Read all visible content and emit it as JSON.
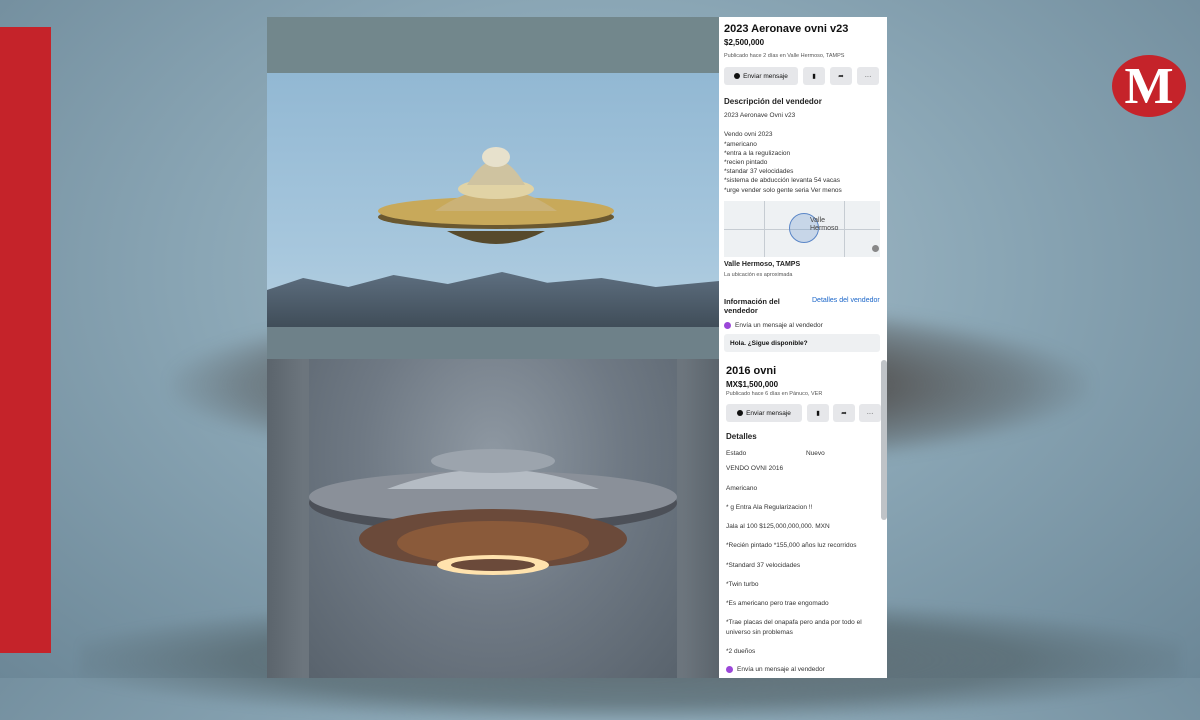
{
  "brand": {
    "logo_letter": "M",
    "accent": "#c5232a"
  },
  "listing1": {
    "title": "2023 Aeronave ovni v23",
    "price": "$2,500,000",
    "posted": "Publicado hace 2 días en Valle Hermoso, TAMPS",
    "actions": {
      "message": "Enviar mensaje"
    },
    "description_heading": "Descripción del vendedor",
    "description_lines": [
      "2023 Aeronave Ovni v23",
      "",
      "Vendo ovni 2023",
      "*americano",
      "*entra a la regulizacion",
      "*recien pintado",
      "*standar 37 velocidades",
      "*sistema de abducción levanta 54 vacas",
      "*urge vender solo gente seria Ver menos"
    ],
    "map_label_1": "Valle",
    "map_label_2": "Hermoso",
    "location": "Valle Hermoso, TAMPS",
    "location_note": "La ubicación es aproximada",
    "seller_info": "Información del",
    "seller_info_2": "vendedor",
    "seller_details_link": "Detalles del vendedor",
    "send_message_label": "Envía un mensaje al vendedor",
    "message_input": "Hola. ¿Sigue disponible?"
  },
  "listing2": {
    "title": "2016 ovni",
    "price": "MX$1,500,000",
    "posted": "Publicado hace 6 días en Pánuco, VER",
    "actions": {
      "message": "Enviar mensaje"
    },
    "details_heading": "Detalles",
    "estado_label": "Estado",
    "estado_value": "Nuevo",
    "description_lines": [
      "VENDO OVNI 2016",
      "Americano",
      "* g Entra Ala Regularizacion !!",
      "Jala al 100 $125,000,000,000. MXN",
      "*Recién pintado *155,000 años luz recorridos",
      "*Standard 37 velocidades",
      "*Twin turbo",
      "*Es americano pero trae engomado",
      "*Trae placas del onapafa pero anda por todo el",
      "universo sin problemas",
      "*2 dueños"
    ],
    "send_message_label": "Envía un mensaje al vendedor"
  }
}
